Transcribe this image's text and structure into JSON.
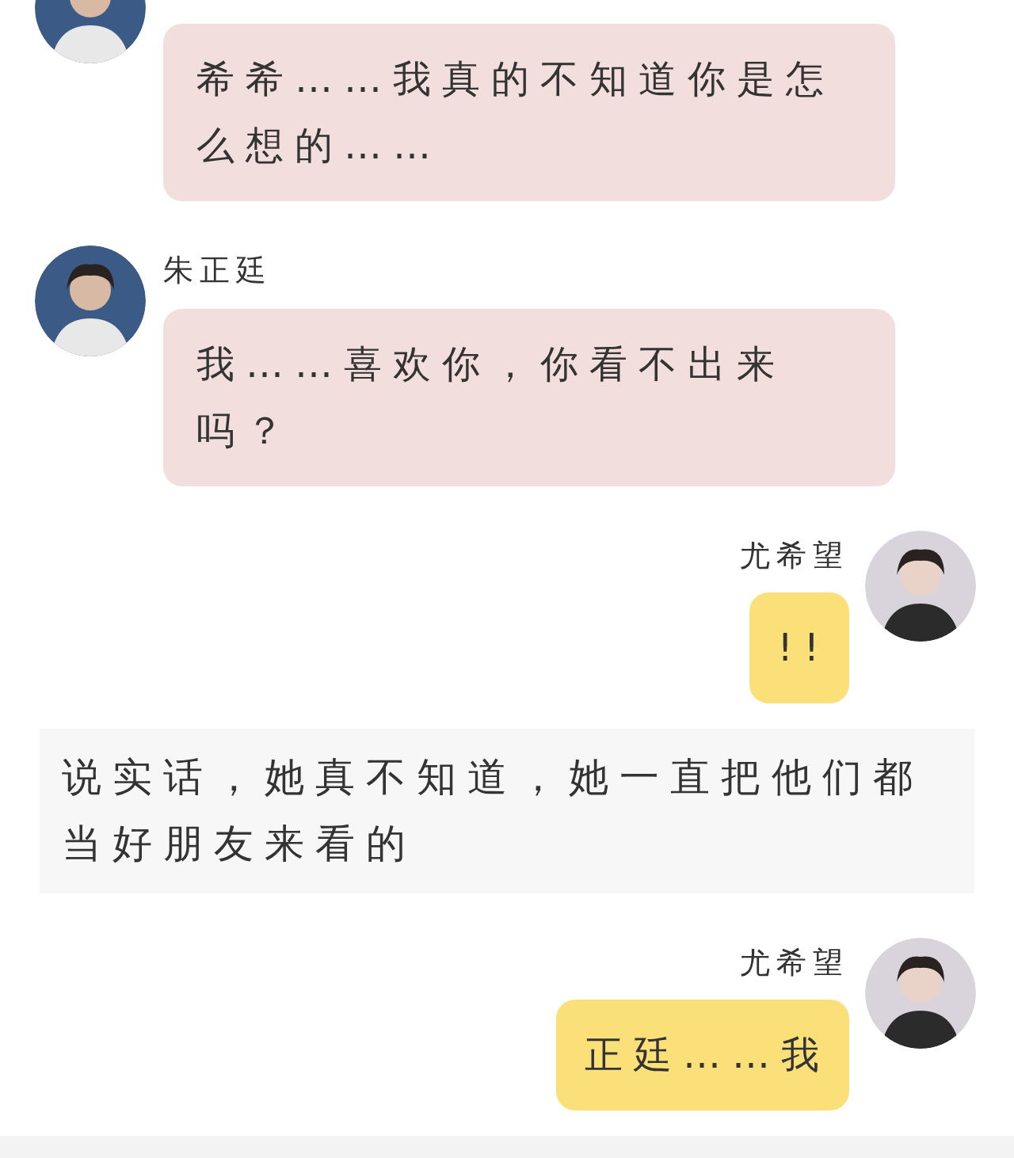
{
  "messages": [
    {
      "kind": "received",
      "text": "希希……我真的不知道你是怎么想的……"
    },
    {
      "kind": "received",
      "name": "朱正廷",
      "text": "我……喜欢你，你看不出来吗？"
    },
    {
      "kind": "sent",
      "name": "尤希望",
      "text": "!!"
    },
    {
      "kind": "narration",
      "text": "说实话，她真不知道，她一直把他们都当好朋友来看的"
    },
    {
      "kind": "sent",
      "name": "尤希望",
      "text": "正廷……我"
    }
  ]
}
